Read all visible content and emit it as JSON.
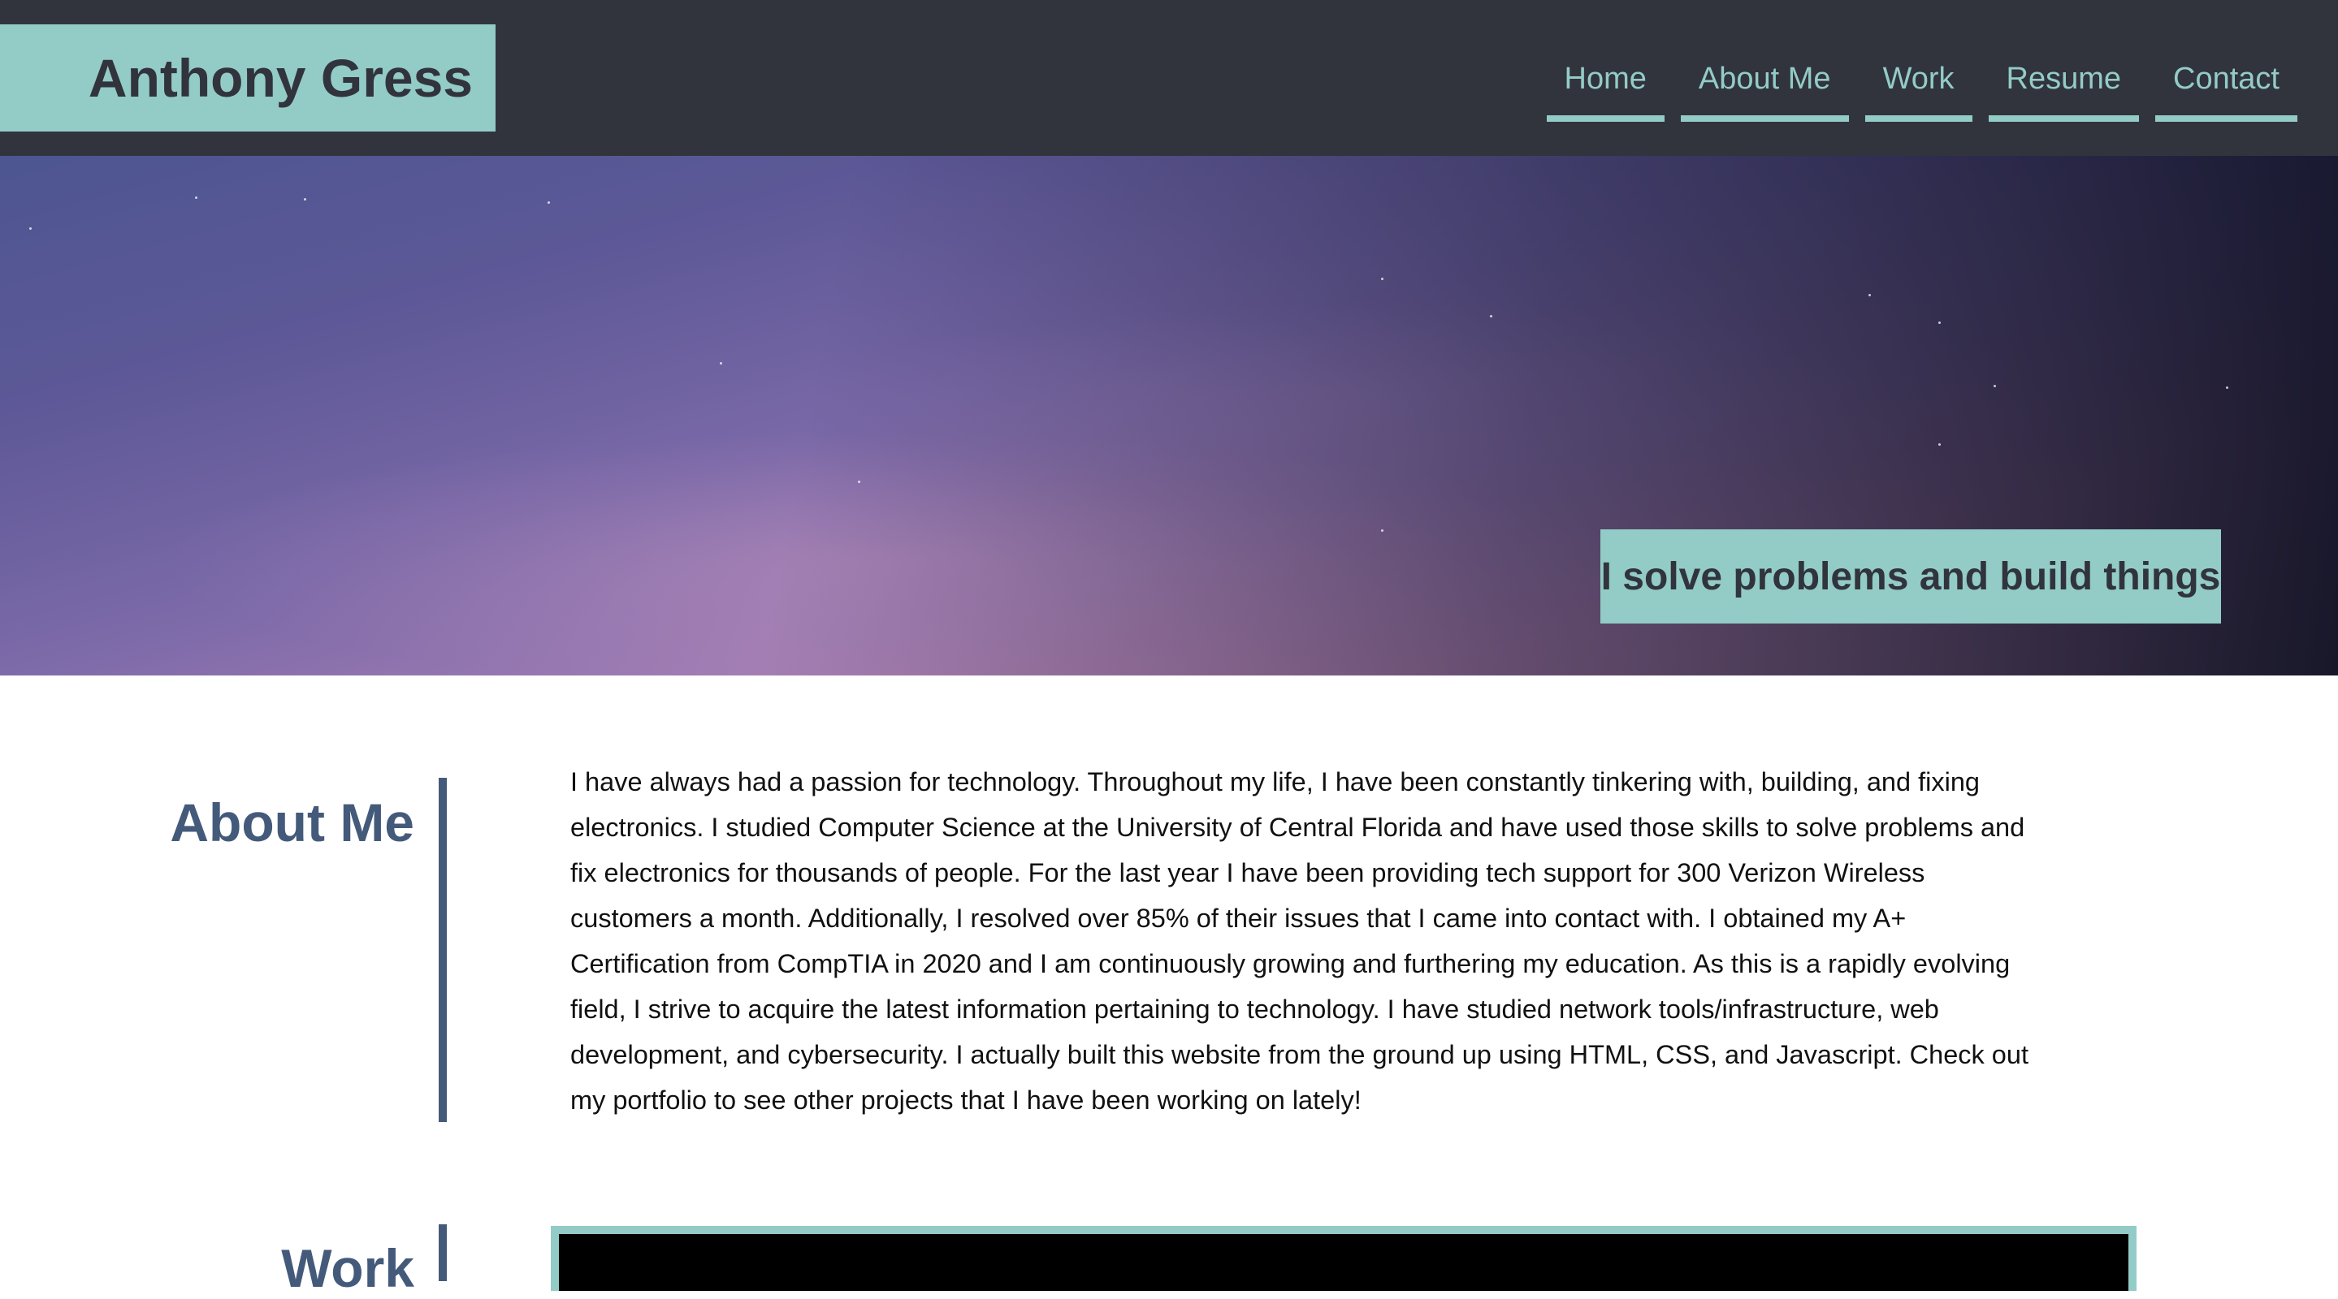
{
  "header": {
    "brand": "Anthony Gress",
    "nav": [
      {
        "label": "Home"
      },
      {
        "label": "About Me"
      },
      {
        "label": "Work"
      },
      {
        "label": "Resume"
      },
      {
        "label": "Contact"
      }
    ]
  },
  "hero": {
    "tagline": "I solve problems and build things"
  },
  "about": {
    "heading": "About Me",
    "body": "I have always had a passion for technology. Throughout my life, I have been constantly tinkering with, building, and fixing electronics. I studied Computer Science at the University of Central Florida and have used those skills to solve problems and fix electronics for thousands of people. For the last year I have been providing tech support for 300 Verizon Wireless customers a month. Additionally, I resolved over 85% of their issues that I came into contact with. I obtained my A+ Certification from CompTIA in 2020 and I am continuously growing and furthering my education. As this is a rapidly evolving field, I strive to acquire the latest information pertaining to technology. I have studied network tools/infrastructure, web development, and cybersecurity. I actually built this website from the ground up using HTML, CSS, and Javascript. Check out my portfolio to see other projects that I have been working on lately!"
  },
  "work": {
    "heading": "Work"
  },
  "colors": {
    "header_bg": "#31343c",
    "accent": "#93cbc7",
    "heading": "#445a7a"
  }
}
